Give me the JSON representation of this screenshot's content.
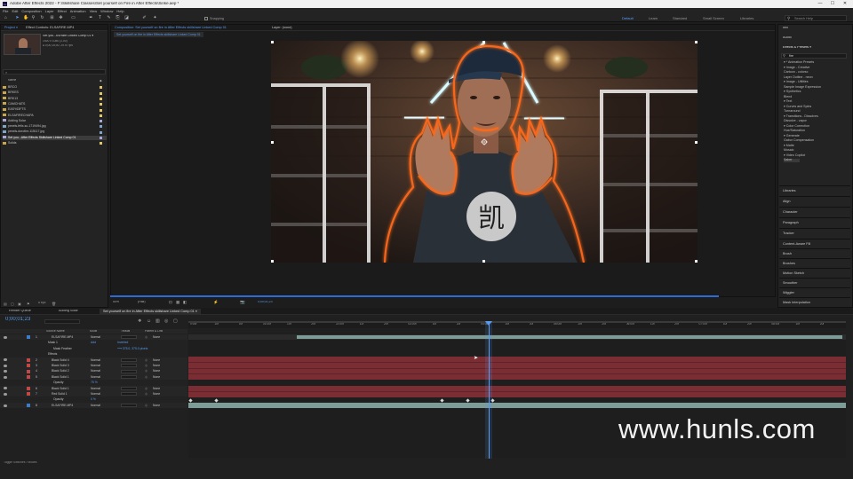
{
  "window": {
    "title": "Adobe After Effects 2022 - F:\\Skillshare Classes\\Set yourself on Fire in After Effects\\Sinke.aep *",
    "minimize": "—",
    "maximize": "☐",
    "close": "✕"
  },
  "menu": [
    "File",
    "Edit",
    "Composition",
    "Layer",
    "Effect",
    "Animation",
    "View",
    "Window",
    "Help"
  ],
  "toolbar": {
    "snapping": "Snapping",
    "workspaces": [
      "Default",
      "Learn",
      "Standard",
      "Small Screen",
      "Libraries"
    ],
    "search": "Search Help"
  },
  "project": {
    "tabs": [
      "Project ≡",
      "Effect Controls: ELSAFIRE.MP4"
    ],
    "item_name": "Set you...kSHare Linked Comp 01 ▾",
    "item_info": [
      "1920 x 1080 (1.00)",
      "Δ 0;00;15;00, 29.97 fps"
    ],
    "search_placeholder": "⌕",
    "col_name": "Name",
    "items": [
      {
        "name": "BRCO",
        "type": "folder"
      },
      {
        "name": "BRKES",
        "type": "folder"
      },
      {
        "name": "BRK13",
        "type": "folder"
      },
      {
        "name": "CAMCHATS",
        "type": "folder"
      },
      {
        "name": "EASY63FTS",
        "type": "folder"
      },
      {
        "name": "ELSAFIRECHAPA",
        "type": "folder"
      },
      {
        "name": "Adding Solar",
        "type": "comp"
      },
      {
        "name": "pexels-felix-sc-1719494.jpg",
        "type": "img"
      },
      {
        "name": "pexels-dorothe-115117.jpg",
        "type": "img"
      },
      {
        "name": "Set you...After Effects Skillshare Linked Comp 01",
        "type": "comp",
        "selected": true
      },
      {
        "name": "Solids",
        "type": "folder"
      }
    ],
    "footer": "8 bpc"
  },
  "comp": {
    "tabs": [
      "Composition: Set yourself on fire in After Effects skillshare Linked Comp 01",
      "Layer: (none)"
    ],
    "subtab": "Set yourself on fire in After Effects skillshare Linked Comp 01",
    "zoom": "50%",
    "quality": "(Half)",
    "timecode": "0;00;01;23",
    "shirt_glyph": "凯"
  },
  "right": {
    "top": [
      "Info",
      "Audio"
    ],
    "effects_title": "Effects & Presets ≡",
    "effects_search": "fire",
    "tree": [
      "▾ * Animation Presets",
      "  ▾ Image - Creative",
      "       Cartoon - colorsc",
      "       Layer Outline - neon",
      "  ▾ Image - Utilities",
      "       Sample Image Expression",
      "  ▾ Synthetics",
      "       Blend",
      "  ▾ Text",
      "     ▾ Curves and Spins",
      "          Turnaround",
      "     ▾ Transitions - Dissolves",
      "          Dissolve - vapor",
      "▾ Color Correction",
      "     Hue/Saturation",
      "▾ Generate",
      "     Gabor Compensation",
      "▾ Matte",
      "     Mosaic",
      "▾ Video Copilot",
      "     Saber"
    ],
    "sections": [
      "Libraries",
      "Align",
      "Character",
      "Paragraph",
      "Tracker",
      "Content-Aware Fill",
      "Brush",
      "Brushes",
      "Motion Sketch",
      "Smoother",
      "Wiggler",
      "Mask Interpolation"
    ]
  },
  "timeline": {
    "tabs": [
      "Render Queue",
      "Adding Solar",
      "Set yourself on fire in After Effects skillshare Linked Comp 01 ≡"
    ],
    "timecode": "0;00;01;23",
    "col_headers": {
      "source": "Source Name",
      "mode": "Mode",
      "trkmat": "TrkMat",
      "parent": "Parent & Link"
    },
    "ticks": [
      "0:00f",
      "10f",
      "20f",
      "01:00f",
      "10f",
      "20f",
      "02:00f",
      "10f",
      "20f",
      "03:00f",
      "10f",
      "20f",
      "04:00f",
      "10f",
      "20f",
      "05:00f",
      "10f",
      "20f",
      "06:00f",
      "10f",
      "20f",
      "07:00f",
      "10f",
      "20f",
      "08:00f",
      "10f",
      "20f"
    ],
    "layers": [
      {
        "num": "1",
        "name": "ELSAFIRE.MP4",
        "mode": "Normal",
        "parent": "None",
        "color": "#3d7cc8",
        "kind": "layer"
      },
      {
        "num": "",
        "name": "Mask 1",
        "mode": "Add",
        "parent": "Inverted",
        "kind": "sub"
      },
      {
        "num": "",
        "name": "Mask Feather",
        "mode": "",
        "parent": "⟶ 375.0, 375.0 pixels",
        "kind": "sub2"
      },
      {
        "num": "",
        "name": "Effects",
        "mode": "",
        "parent": "",
        "kind": "sub"
      },
      {
        "num": "2",
        "name": "Black Solid 4",
        "mode": "Normal",
        "parent": "None",
        "color": "#c24848",
        "kind": "layer"
      },
      {
        "num": "3",
        "name": "Black Solid 3",
        "mode": "Normal",
        "parent": "None",
        "color": "#c24848",
        "kind": "layer"
      },
      {
        "num": "4",
        "name": "Black Solid 2",
        "mode": "Normal",
        "parent": "None",
        "color": "#c24848",
        "kind": "layer"
      },
      {
        "num": "5",
        "name": "Black Solid 1",
        "mode": "Normal",
        "parent": "None",
        "color": "#c24848",
        "kind": "layer"
      },
      {
        "num": "",
        "name": "Opacity",
        "mode": "75 %",
        "parent": "",
        "kind": "sub2"
      },
      {
        "num": "6",
        "name": "Black Solid 1",
        "mode": "Normal",
        "parent": "None",
        "color": "#c24848",
        "kind": "layer"
      },
      {
        "num": "7",
        "name": "Red Solid 1",
        "mode": "Normal",
        "parent": "None",
        "color": "#c24848",
        "kind": "layer"
      },
      {
        "num": "",
        "name": "Opacity",
        "mode": "0 %",
        "parent": "",
        "kind": "sub2"
      },
      {
        "num": "8",
        "name": "ELSAFIRE.MP4",
        "mode": "Normal",
        "parent": "None",
        "color": "#3d7cc8",
        "kind": "layer"
      }
    ],
    "footer": "Toggle Switches / Modes"
  },
  "watermark": "www.hunls.com",
  "colors": {
    "accent": "#5a9cf0",
    "fire": "#ff6a1a",
    "red_layer": "#7a2e34",
    "teal_layer": "#7d9c98"
  }
}
